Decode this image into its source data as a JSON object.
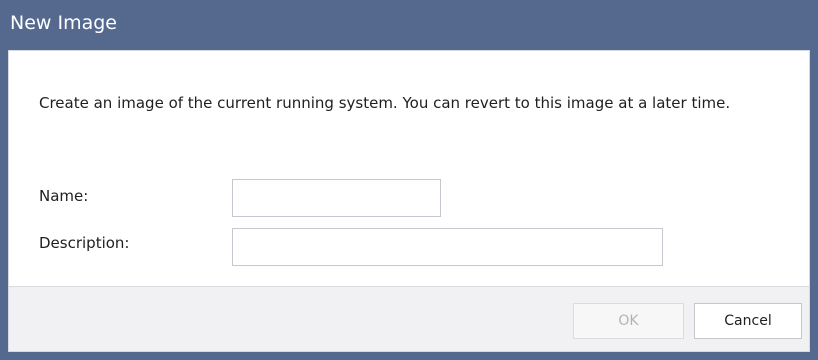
{
  "window": {
    "title": "New Image"
  },
  "dialog": {
    "message": "Create an image of the current running system. You can revert to this image at a later time.",
    "fields": {
      "name": {
        "label": "Name:",
        "value": ""
      },
      "description": {
        "label": "Description:",
        "value": ""
      }
    },
    "buttons": {
      "ok": {
        "label": "OK",
        "enabled": false
      },
      "cancel": {
        "label": "Cancel",
        "enabled": true
      }
    }
  },
  "colors": {
    "titlebar": "#55698e",
    "footer": "#f1f1f3",
    "disabled_text": "#b2b4b8"
  }
}
